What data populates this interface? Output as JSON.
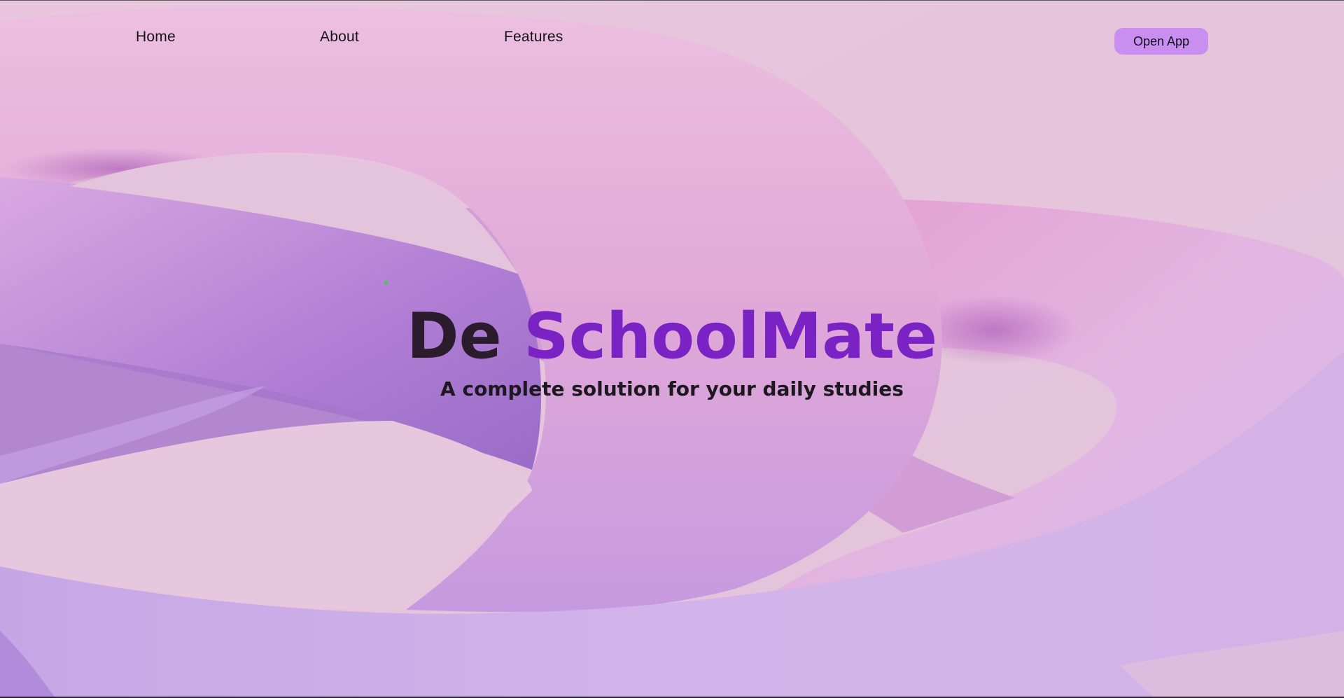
{
  "nav": {
    "links": [
      {
        "label": "Home"
      },
      {
        "label": "About"
      },
      {
        "label": "Features"
      }
    ],
    "cta_label": "Open App"
  },
  "hero": {
    "title_first": "De",
    "title_second": "SchoolMate",
    "subtitle": "A complete solution for your daily studies"
  },
  "colors": {
    "background": "#e4c8dc",
    "accent": "#7a22c4",
    "button": "#c88ff0",
    "ring_pink": "#e8a8d8",
    "ring_purple": "#b88ae0"
  }
}
